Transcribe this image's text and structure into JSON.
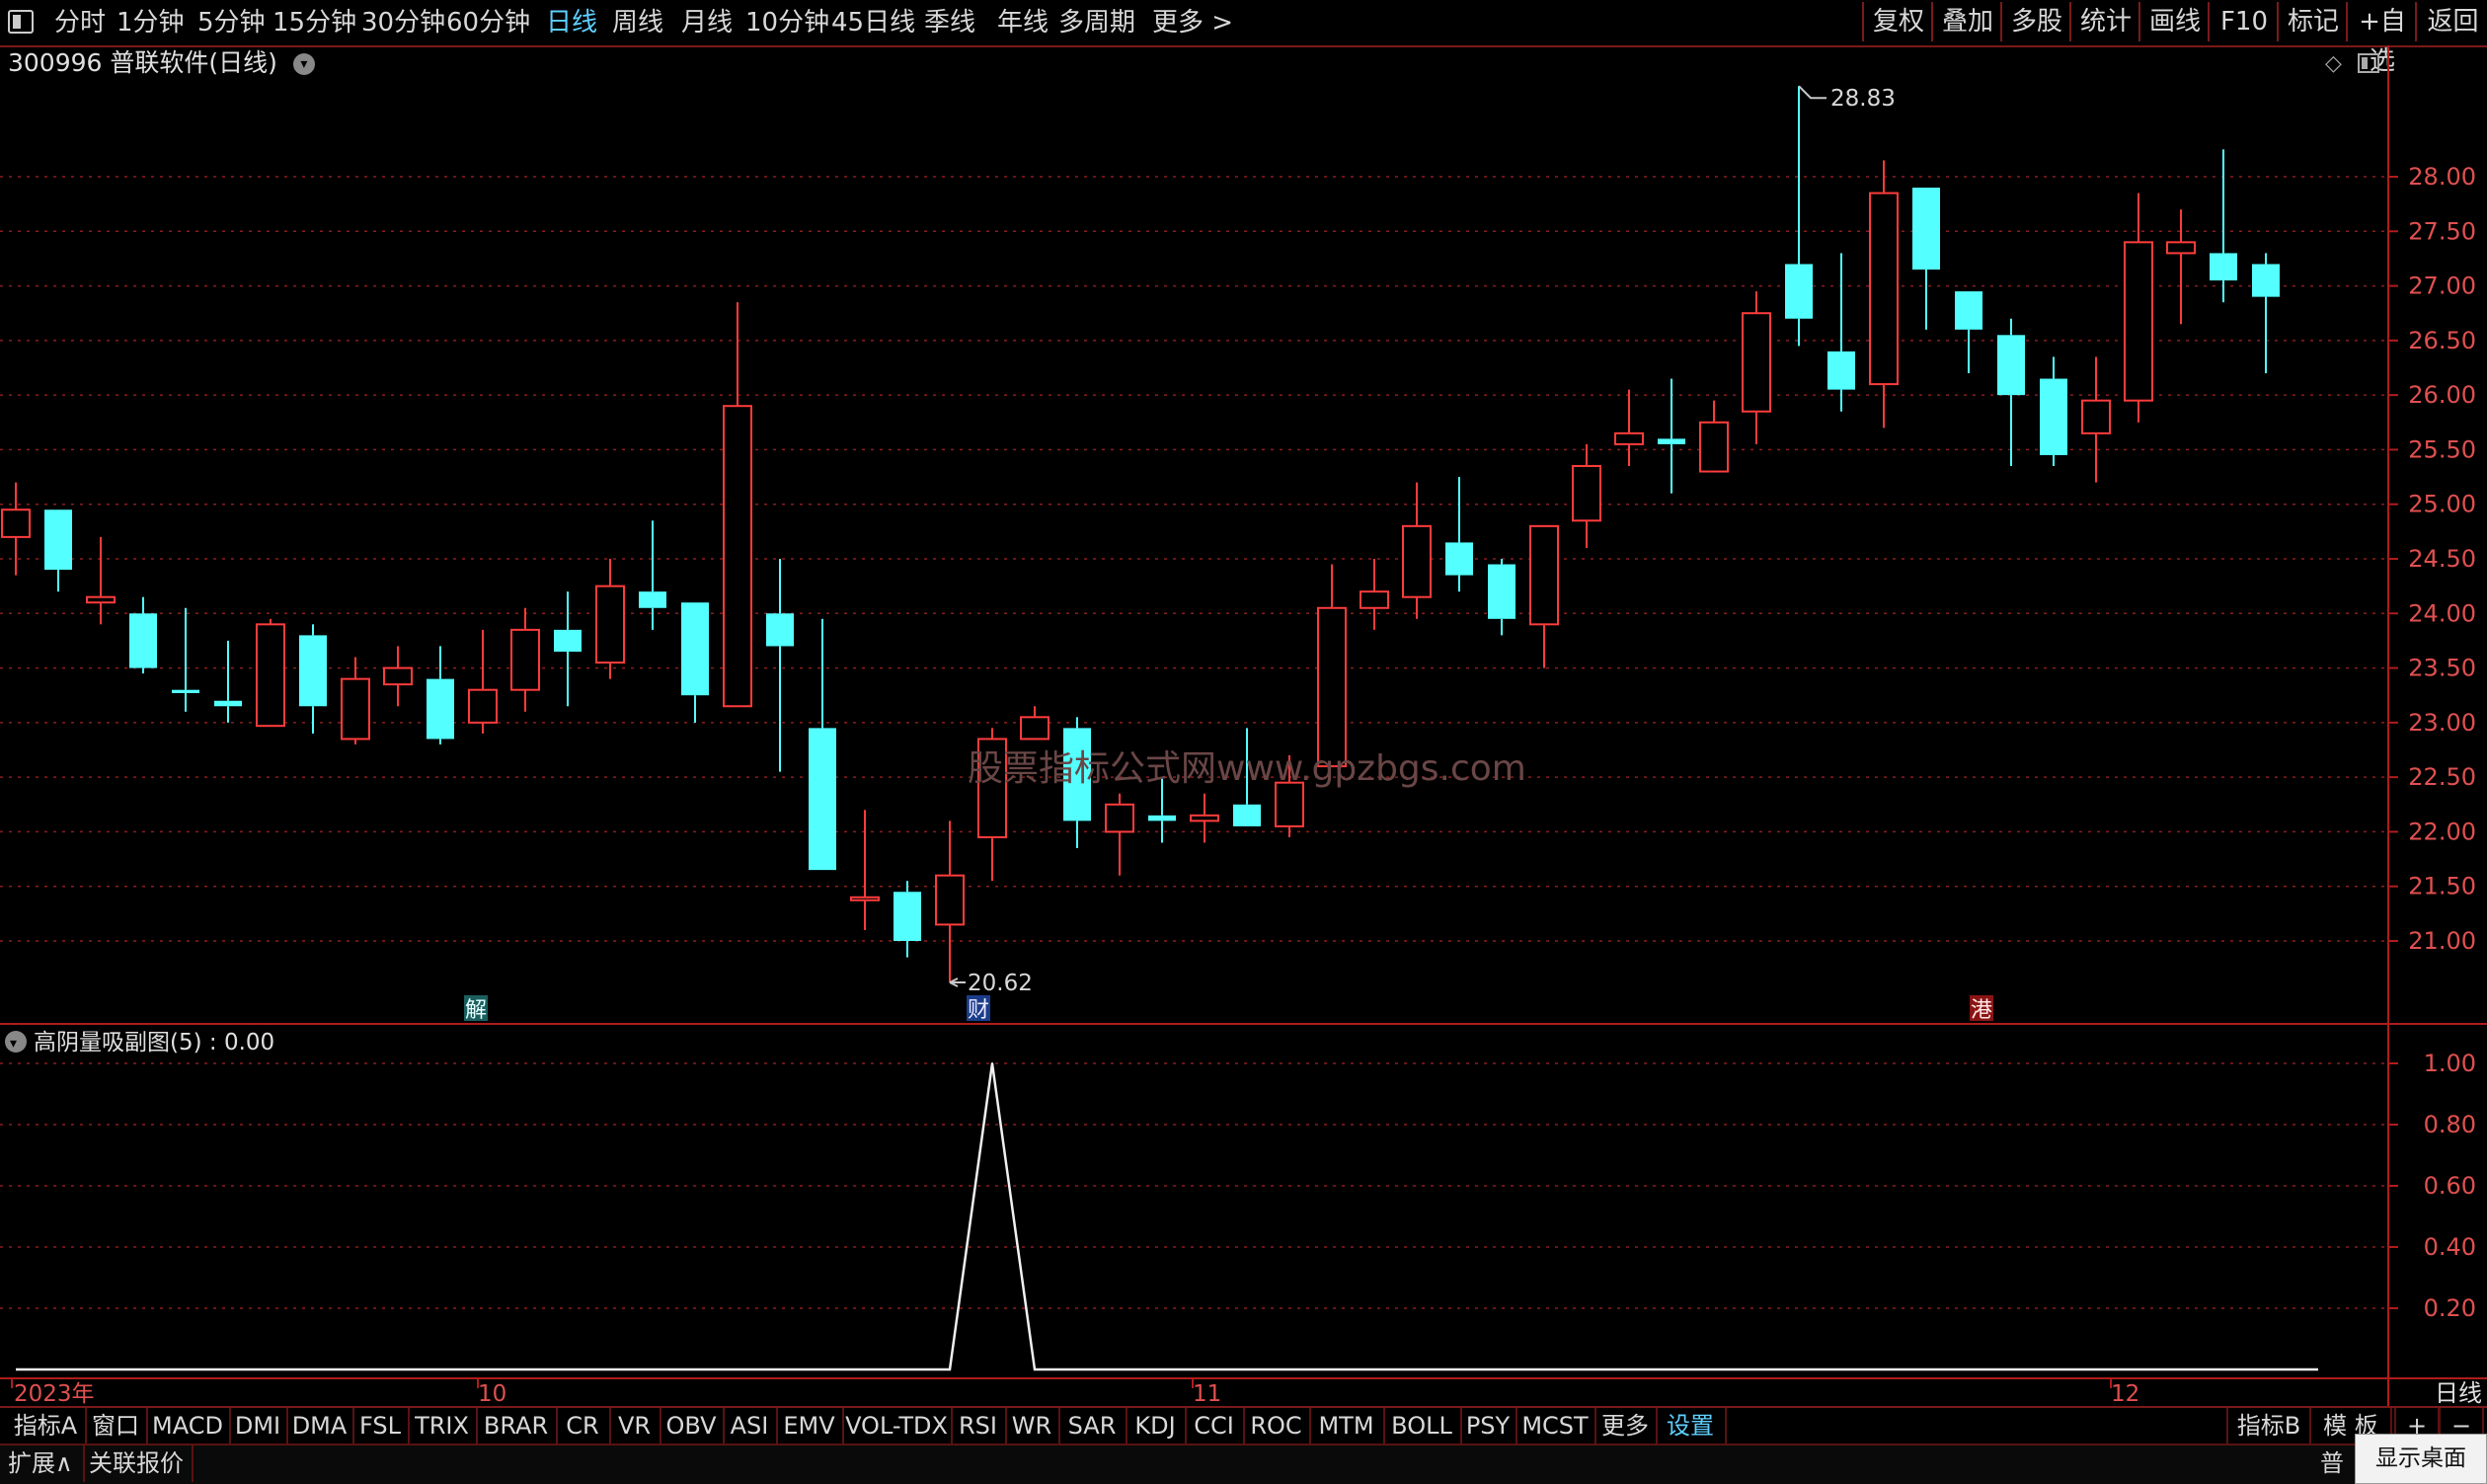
{
  "toolbar": {
    "periods": [
      "分时",
      "1分钟",
      "5分钟",
      "15分钟",
      "30分钟",
      "60分钟",
      "日线",
      "周线",
      "月线",
      "10分钟",
      "45日线",
      "季线",
      "年线",
      "多周期",
      "更多 >"
    ],
    "active_period": "日线",
    "right_items": [
      "复权",
      "叠加",
      "多股",
      "统计",
      "画线",
      "F10",
      "标记",
      "+自选",
      "返回"
    ]
  },
  "chart": {
    "title": "300996 普联软件(日线)",
    "high_label": "28.83",
    "low_label": "20.62",
    "watermark": "股票指标公式网www.gpzbgs.com",
    "price_ticks": [
      "28.00",
      "27.50",
      "27.00",
      "26.50",
      "26.00",
      "25.50",
      "25.00",
      "24.50",
      "24.00",
      "23.50",
      "23.00",
      "22.50",
      "22.00",
      "21.50",
      "21.00"
    ],
    "markers": [
      "解",
      "财",
      "港"
    ],
    "colors": {
      "up": "#ff3c3c",
      "down": "#54ffff",
      "grid": "#8a1e1e",
      "axis": "#b01c1c"
    }
  },
  "indicator": {
    "title": "高阴量吸副图(5) : 0.00",
    "ticks": [
      "1.00",
      "0.80",
      "0.60",
      "0.40",
      "0.20"
    ]
  },
  "date_axis": {
    "labels": [
      "2023年",
      "10",
      "11",
      "12"
    ],
    "period": "日线"
  },
  "chart_data": {
    "type": "candlestick",
    "price_ylim": [
      20.5,
      28.9
    ],
    "candles": [
      {
        "o": 24.7,
        "c": 24.95,
        "h": 25.2,
        "l": 24.35
      },
      {
        "o": 24.95,
        "c": 24.4,
        "h": 24.95,
        "l": 24.2
      },
      {
        "o": 24.1,
        "c": 24.15,
        "h": 24.7,
        "l": 23.9
      },
      {
        "o": 24.0,
        "c": 23.5,
        "h": 24.15,
        "l": 23.45
      },
      {
        "o": 23.3,
        "c": 23.27,
        "h": 24.05,
        "l": 23.1
      },
      {
        "o": 23.2,
        "c": 23.15,
        "h": 23.75,
        "l": 23.0
      },
      {
        "o": 22.97,
        "c": 23.9,
        "h": 23.95,
        "l": 22.97
      },
      {
        "o": 23.8,
        "c": 23.15,
        "h": 23.9,
        "l": 22.9
      },
      {
        "o": 22.85,
        "c": 23.4,
        "h": 23.6,
        "l": 22.8
      },
      {
        "o": 23.35,
        "c": 23.5,
        "h": 23.7,
        "l": 23.15
      },
      {
        "o": 23.4,
        "c": 22.85,
        "h": 23.7,
        "l": 22.8
      },
      {
        "o": 23.0,
        "c": 23.3,
        "h": 23.85,
        "l": 22.9
      },
      {
        "o": 23.3,
        "c": 23.85,
        "h": 24.05,
        "l": 23.1
      },
      {
        "o": 23.85,
        "c": 23.65,
        "h": 24.2,
        "l": 23.15
      },
      {
        "o": 23.55,
        "c": 24.25,
        "h": 24.5,
        "l": 23.4
      },
      {
        "o": 24.2,
        "c": 24.05,
        "h": 24.85,
        "l": 23.85
      },
      {
        "o": 24.1,
        "c": 23.25,
        "h": 24.1,
        "l": 23.0
      },
      {
        "o": 23.15,
        "c": 25.9,
        "h": 26.85,
        "l": 23.15
      },
      {
        "o": 24.0,
        "c": 23.7,
        "h": 24.5,
        "l": 22.55
      },
      {
        "o": 22.95,
        "c": 21.65,
        "h": 23.95,
        "l": 21.65
      },
      {
        "o": 21.4,
        "c": 21.4,
        "h": 22.2,
        "l": 21.1
      },
      {
        "o": 21.45,
        "c": 21.0,
        "h": 21.55,
        "l": 20.85
      },
      {
        "o": 21.15,
        "c": 21.6,
        "h": 22.1,
        "l": 20.62
      },
      {
        "o": 21.95,
        "c": 22.85,
        "h": 22.95,
        "l": 21.55
      },
      {
        "o": 22.85,
        "c": 23.05,
        "h": 23.15,
        "l": 22.85
      },
      {
        "o": 22.95,
        "c": 22.1,
        "h": 23.05,
        "l": 21.85
      },
      {
        "o": 22.0,
        "c": 22.25,
        "h": 22.35,
        "l": 21.6
      },
      {
        "o": 22.15,
        "c": 22.1,
        "h": 22.5,
        "l": 21.9
      },
      {
        "o": 22.1,
        "c": 22.15,
        "h": 22.35,
        "l": 21.9
      },
      {
        "o": 22.25,
        "c": 22.05,
        "h": 22.95,
        "l": 22.05
      },
      {
        "o": 22.05,
        "c": 22.45,
        "h": 22.7,
        "l": 21.95
      },
      {
        "o": 22.6,
        "c": 24.05,
        "h": 24.45,
        "l": 22.6
      },
      {
        "o": 24.05,
        "c": 24.2,
        "h": 24.5,
        "l": 23.85
      },
      {
        "o": 24.15,
        "c": 24.8,
        "h": 25.2,
        "l": 23.95
      },
      {
        "o": 24.65,
        "c": 24.35,
        "h": 25.25,
        "l": 24.2
      },
      {
        "o": 24.45,
        "c": 23.95,
        "h": 24.5,
        "l": 23.8
      },
      {
        "o": 23.9,
        "c": 24.8,
        "h": 24.8,
        "l": 23.5
      },
      {
        "o": 24.85,
        "c": 25.35,
        "h": 25.55,
        "l": 24.6
      },
      {
        "o": 25.55,
        "c": 25.65,
        "h": 26.05,
        "l": 25.35
      },
      {
        "o": 25.6,
        "c": 25.55,
        "h": 26.15,
        "l": 25.1
      },
      {
        "o": 25.3,
        "c": 25.75,
        "h": 25.95,
        "l": 25.3
      },
      {
        "o": 25.85,
        "c": 26.75,
        "h": 26.95,
        "l": 25.55
      },
      {
        "o": 27.2,
        "c": 26.7,
        "h": 28.83,
        "l": 26.45
      },
      {
        "o": 26.4,
        "c": 26.05,
        "h": 27.3,
        "l": 25.85
      },
      {
        "o": 26.1,
        "c": 27.85,
        "h": 28.15,
        "l": 25.7
      },
      {
        "o": 27.9,
        "c": 27.15,
        "h": 27.9,
        "l": 26.6
      },
      {
        "o": 26.95,
        "c": 26.6,
        "h": 26.95,
        "l": 26.2
      },
      {
        "o": 26.55,
        "c": 26.0,
        "h": 26.7,
        "l": 25.35
      },
      {
        "o": 26.15,
        "c": 25.45,
        "h": 26.35,
        "l": 25.35
      },
      {
        "o": 25.65,
        "c": 25.95,
        "h": 26.35,
        "l": 25.2
      },
      {
        "o": 25.95,
        "c": 27.4,
        "h": 27.85,
        "l": 25.75
      },
      {
        "o": 27.3,
        "c": 27.4,
        "h": 27.7,
        "l": 26.65
      },
      {
        "o": 27.3,
        "c": 27.05,
        "h": 28.25,
        "l": 26.85
      },
      {
        "o": 27.2,
        "c": 26.9,
        "h": 27.3,
        "l": 26.2
      }
    ],
    "indicator_ylim": [
      0,
      1.05
    ],
    "indicator_values": [
      0,
      0,
      0,
      0,
      0,
      0,
      0,
      0,
      0,
      0,
      0,
      0,
      0,
      0,
      0,
      0,
      0,
      0,
      0,
      0,
      0,
      0,
      0,
      1,
      0,
      0,
      0,
      0,
      0,
      0,
      0,
      0,
      0,
      0,
      0,
      0,
      0,
      0,
      0,
      0,
      0,
      0,
      0,
      0,
      0,
      0,
      0,
      0,
      0,
      0,
      0,
      0,
      0,
      0
    ]
  },
  "bottom_tabs": {
    "items": [
      "指标A",
      "窗口",
      "MACD",
      "DMI",
      "DMA",
      "FSL",
      "TRIX",
      "BRAR",
      "CR",
      "VR",
      "OBV",
      "ASI",
      "EMV",
      "VOL-TDX",
      "RSI",
      "WR",
      "SAR",
      "KDJ",
      "CCI",
      "ROC",
      "MTM",
      "BOLL",
      "PSY",
      "MCST",
      "更多",
      "设置"
    ],
    "active": "设置",
    "right_items": [
      "指标B",
      "模 板",
      "+",
      "−"
    ]
  },
  "status": {
    "expand": "扩展∧",
    "linked_quote": "关联报价",
    "right_cut": "普双",
    "show_desktop": "显示桌面"
  }
}
